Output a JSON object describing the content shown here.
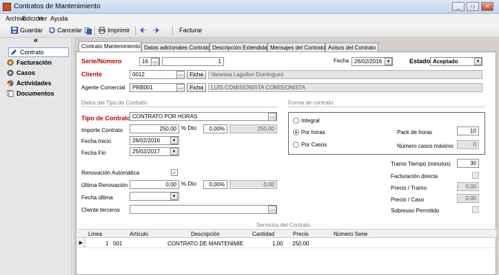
{
  "window": {
    "title": "Contratos de Mantenimiento",
    "controls": [
      "_",
      "□",
      "✕"
    ]
  },
  "menu": [
    "Archivo",
    "Edicion",
    "Ver",
    "Ayuda"
  ],
  "toolbar": {
    "save": "Guardar",
    "cancel": "Cancelar",
    "print": "Imprimir",
    "invoice": "Facturar"
  },
  "sidebar": {
    "collapse": "«",
    "items": [
      {
        "label": "Contrato",
        "icon": "pen-icon",
        "selected": true
      },
      {
        "label": "Facturación",
        "icon": "gear-icon"
      },
      {
        "label": "Casos",
        "icon": "gear-icon"
      },
      {
        "label": "Actividades",
        "icon": "rainbow-icon"
      },
      {
        "label": "Documentos",
        "icon": "documents-icon"
      }
    ]
  },
  "tabs": [
    "Contrato Mantenimiento",
    "Datos adicionales Contrato",
    "Descripción Extendida",
    "Mensajes del Contrato",
    "Avisos del Contrato"
  ],
  "header": {
    "serie_label": "Serie/Número",
    "serie": "16",
    "serie_btn": "...",
    "numero": "1",
    "fecha_label": "Fecha",
    "fecha": "26/02/2016",
    "estado_label": "Estado",
    "estado": "Aceptado",
    "cliente_label": "Cliente",
    "cliente_code": "0012",
    "ficha_label": "Ficha",
    "cliente_name": "Vanessa Lagullon Dominguez",
    "agente_label": "Agente Comercial",
    "agente_code": "PRB001",
    "agente_name": "LUIS COMISIONISTA COMISIONISTA"
  },
  "datos_tipo": {
    "section": "Datos del Tipo de Contrato",
    "tipo_label": "Tipo de Contrato",
    "tipo": "CONTRATO POR HORAS",
    "importe_label": "Importe Contrato",
    "importe": "250,00",
    "dto_label": "% Dto",
    "dto": "0,00%",
    "total": "250,00",
    "inicio_label": "Fecha Inicio",
    "inicio": "26/02/2016",
    "fin_label": "Fecha Fin",
    "fin": "25/02/2017",
    "renov_label": "Renovación Automática",
    "renov": true,
    "ult_renov_label": "Última Renovación",
    "ult_renov": "0,00",
    "ult_dto_label": "% Dto",
    "ult_dto": "0,00%",
    "ult_total": "0,00",
    "fecha_ultima_label": "Fecha última",
    "fecha_ultima": "",
    "terceros_label": "Cliente terceros",
    "terceros": ""
  },
  "forma": {
    "section": "Forma de contrato",
    "options": [
      "Integral",
      "Por horas",
      "Por Casos"
    ],
    "selected": "Por horas",
    "pack_label": "Pack de horas",
    "pack": "10",
    "casos_label": "Número casos máximo",
    "casos": "0",
    "tramo_label": "Tramo Tiempo (minutos)",
    "tramo": "30",
    "fact_directa_label": "Facturación directa",
    "precio_tramo_label": "Precio / Tramo",
    "precio_tramo": "0,00",
    "precio_caso_label": "Precio / Caso",
    "precio_caso": "0,00",
    "sobreuso_label": "Sobreuso Permitido"
  },
  "servicios": {
    "title": "Servicios del Contrato",
    "columns": [
      "Línea",
      "Artículo",
      "Descripción",
      "Cantidad",
      "Precio",
      "Número Serie"
    ],
    "rows": [
      {
        "linea": "1",
        "articulo": "001",
        "descripcion": "CONTRATO DE MANTENIMIE",
        "cantidad": "1,00",
        "precio": "250,00",
        "serie": ""
      }
    ]
  }
}
